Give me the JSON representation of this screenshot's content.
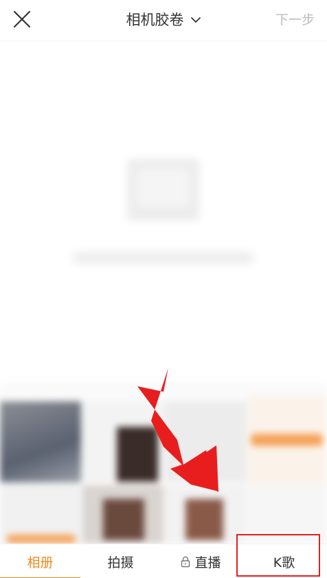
{
  "header": {
    "close_icon": "close-icon",
    "title": "相机胶卷",
    "title_dropdown_icon": "chevron-down-icon",
    "next_label": "下一步"
  },
  "tabs": [
    {
      "label": "相册",
      "active": true
    },
    {
      "label": "拍摄",
      "active": false
    },
    {
      "label": "直播",
      "active": false,
      "icon": "lock-icon"
    },
    {
      "label": "K歌",
      "active": false
    }
  ],
  "annotation": {
    "arrow_icon": "red-arrow-icon",
    "highlight_color": "#e02020"
  },
  "colors": {
    "accent": "#f08a1e",
    "next_disabled": "#bdbdbd"
  }
}
